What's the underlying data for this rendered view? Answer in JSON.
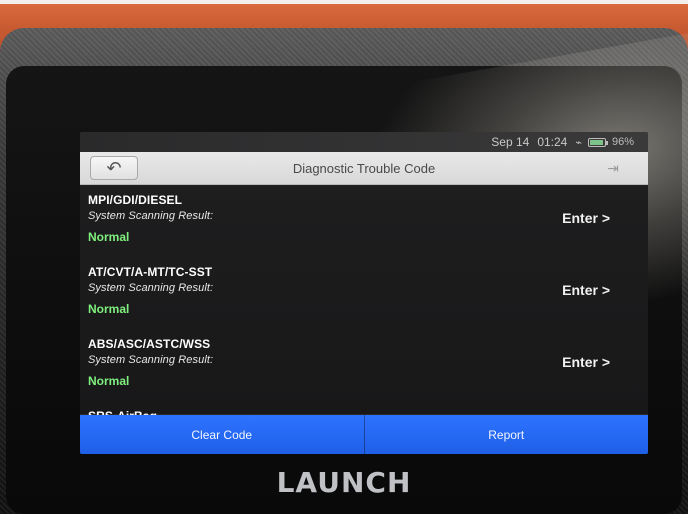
{
  "status": {
    "date": "Sep 14",
    "time": "01:24",
    "battery": "96%"
  },
  "header": {
    "title": "Diagnostic Trouble Code"
  },
  "rows": [
    {
      "system": "MPI/GDI/DIESEL",
      "label": "System Scanning Result:",
      "result": "Normal",
      "enter": "Enter >"
    },
    {
      "system": "AT/CVT/A-MT/TC-SST",
      "label": "System Scanning Result:",
      "result": "Normal",
      "enter": "Enter >"
    },
    {
      "system": "ABS/ASC/ASTC/WSS",
      "label": "System Scanning Result:",
      "result": "Normal",
      "enter": "Enter >"
    },
    {
      "system": "SRS-AirBag"
    }
  ],
  "footer": {
    "clear_code": "Clear Code",
    "report": "Report"
  },
  "brand": {
    "name": "LAUNCH"
  },
  "colors": {
    "accent_blue": "#2d73ff",
    "normal_green": "#7ff07e"
  }
}
